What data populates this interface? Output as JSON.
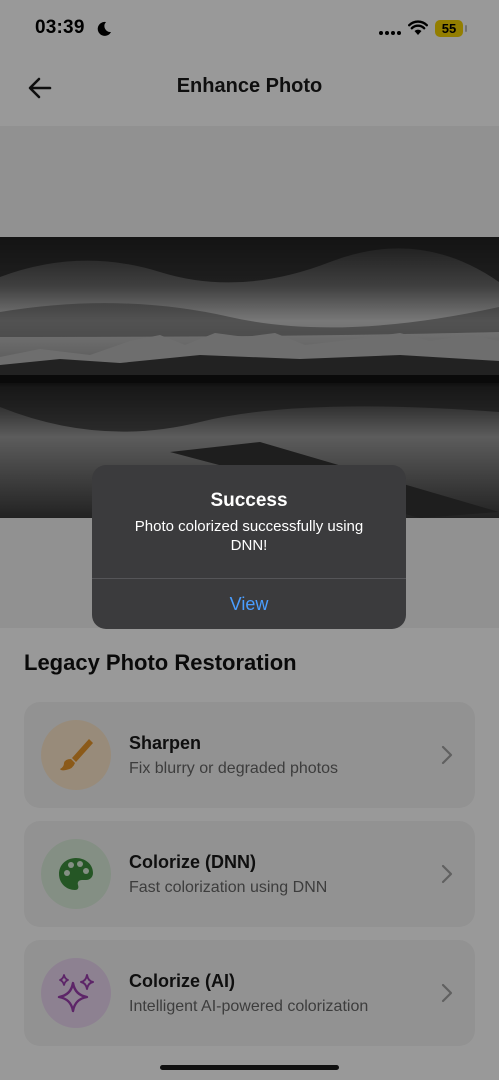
{
  "status_bar": {
    "time": "03:39",
    "battery": "55"
  },
  "header": {
    "title": "Enhance Photo"
  },
  "section_title": "Legacy Photo Restoration",
  "cards": [
    {
      "title": "Sharpen",
      "subtitle": "Fix blurry or degraded photos",
      "icon": "brush-icon",
      "icon_bg": "#fde8cc",
      "icon_color": "#e8962a"
    },
    {
      "title": "Colorize (DNN)",
      "subtitle": "Fast colorization using DNN",
      "icon": "palette-icon",
      "icon_bg": "#dcefdc",
      "icon_color": "#3f8f3f"
    },
    {
      "title": "Colorize (AI)",
      "subtitle": "Intelligent AI-powered colorization",
      "icon": "sparkles-icon",
      "icon_bg": "#ecd8f2",
      "icon_color": "#9b3fae"
    }
  ],
  "alert": {
    "title": "Success",
    "message": "Photo colorized successfully using DNN!",
    "button": "View"
  }
}
